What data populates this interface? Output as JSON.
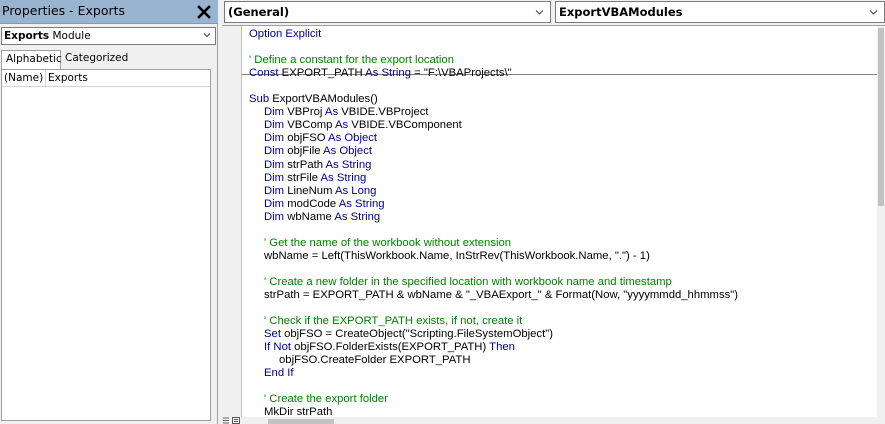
{
  "properties": {
    "title": "Properties - Exports",
    "object_name": "Exports",
    "object_type": "Module",
    "tabs": [
      "Alphabetic",
      "Categorized"
    ],
    "active_tab": "Alphabetic",
    "rows": [
      {
        "name": "(Name)",
        "value": "Exports"
      }
    ]
  },
  "code_window": {
    "general_combo": "(General)",
    "procedure_combo": "ExportVBAModules",
    "lines": [
      {
        "indent": 0,
        "parts": [
          {
            "t": "Option Explicit",
            "k": "kw"
          }
        ]
      },
      {
        "indent": 0,
        "parts": []
      },
      {
        "indent": 0,
        "parts": [
          {
            "t": "' Define a constant for the export location",
            "k": "cm"
          }
        ]
      },
      {
        "indent": 0,
        "parts": [
          {
            "t": "Const",
            "k": "kw"
          },
          {
            "t": " EXPORT_PATH ",
            "k": ""
          },
          {
            "t": "As String",
            "k": "kw"
          },
          {
            "t": " = \"F:\\VBAProjects\\\"",
            "k": ""
          }
        ]
      },
      {
        "indent": 0,
        "parts": []
      },
      {
        "indent": 0,
        "parts": [
          {
            "t": "Sub",
            "k": "kw"
          },
          {
            "t": " ExportVBAModules()",
            "k": ""
          }
        ]
      },
      {
        "indent": 1,
        "parts": [
          {
            "t": "Dim",
            "k": "kw"
          },
          {
            "t": " VBProj ",
            "k": ""
          },
          {
            "t": "As",
            "k": "kw"
          },
          {
            "t": " VBIDE.VBProject",
            "k": ""
          }
        ]
      },
      {
        "indent": 1,
        "parts": [
          {
            "t": "Dim",
            "k": "kw"
          },
          {
            "t": " VBComp ",
            "k": ""
          },
          {
            "t": "As",
            "k": "kw"
          },
          {
            "t": " VBIDE.VBComponent",
            "k": ""
          }
        ]
      },
      {
        "indent": 1,
        "parts": [
          {
            "t": "Dim",
            "k": "kw"
          },
          {
            "t": " objFSO ",
            "k": ""
          },
          {
            "t": "As Object",
            "k": "kw"
          }
        ]
      },
      {
        "indent": 1,
        "parts": [
          {
            "t": "Dim",
            "k": "kw"
          },
          {
            "t": " objFile ",
            "k": ""
          },
          {
            "t": "As Object",
            "k": "kw"
          }
        ]
      },
      {
        "indent": 1,
        "parts": [
          {
            "t": "Dim",
            "k": "kw"
          },
          {
            "t": " strPath ",
            "k": ""
          },
          {
            "t": "As String",
            "k": "kw"
          }
        ]
      },
      {
        "indent": 1,
        "parts": [
          {
            "t": "Dim",
            "k": "kw"
          },
          {
            "t": " strFile ",
            "k": ""
          },
          {
            "t": "As String",
            "k": "kw"
          }
        ]
      },
      {
        "indent": 1,
        "parts": [
          {
            "t": "Dim",
            "k": "kw"
          },
          {
            "t": " LineNum ",
            "k": ""
          },
          {
            "t": "As Long",
            "k": "kw"
          }
        ]
      },
      {
        "indent": 1,
        "parts": [
          {
            "t": "Dim",
            "k": "kw"
          },
          {
            "t": " modCode ",
            "k": ""
          },
          {
            "t": "As String",
            "k": "kw"
          }
        ]
      },
      {
        "indent": 1,
        "parts": [
          {
            "t": "Dim",
            "k": "kw"
          },
          {
            "t": " wbName ",
            "k": ""
          },
          {
            "t": "As String",
            "k": "kw"
          }
        ]
      },
      {
        "indent": 0,
        "parts": []
      },
      {
        "indent": 1,
        "parts": [
          {
            "t": "' Get the name of the workbook without extension",
            "k": "cm"
          }
        ]
      },
      {
        "indent": 1,
        "parts": [
          {
            "t": "wbName = Left(ThisWorkbook.Name, InStrRev(ThisWorkbook.Name, \".\") - 1)",
            "k": ""
          }
        ]
      },
      {
        "indent": 0,
        "parts": []
      },
      {
        "indent": 1,
        "parts": [
          {
            "t": "' Create a new folder in the specified location with workbook name and timestamp",
            "k": "cm"
          }
        ]
      },
      {
        "indent": 1,
        "parts": [
          {
            "t": "strPath = EXPORT_PATH & wbName & \"_VBAExport_\" & Format(Now, \"yyyymmdd_hhmmss\")",
            "k": ""
          }
        ]
      },
      {
        "indent": 0,
        "parts": []
      },
      {
        "indent": 1,
        "parts": [
          {
            "t": "' Check if the EXPORT_PATH exists, if not, create it",
            "k": "cm"
          }
        ]
      },
      {
        "indent": 1,
        "parts": [
          {
            "t": "Set",
            "k": "kw"
          },
          {
            "t": " objFSO = CreateObject(\"Scripting.FileSystemObject\")",
            "k": ""
          }
        ]
      },
      {
        "indent": 1,
        "parts": [
          {
            "t": "If Not",
            "k": "kw"
          },
          {
            "t": " objFSO.FolderExists(EXPORT_PATH) ",
            "k": ""
          },
          {
            "t": "Then",
            "k": "kw"
          }
        ]
      },
      {
        "indent": 2,
        "parts": [
          {
            "t": "objFSO.CreateFolder EXPORT_PATH",
            "k": ""
          }
        ]
      },
      {
        "indent": 1,
        "parts": [
          {
            "t": "End If",
            "k": "kw"
          }
        ]
      },
      {
        "indent": 0,
        "parts": []
      },
      {
        "indent": 1,
        "parts": [
          {
            "t": "' Create the export folder",
            "k": "cm"
          }
        ]
      },
      {
        "indent": 1,
        "parts": [
          {
            "t": "MkDir strPath",
            "k": ""
          }
        ]
      }
    ]
  },
  "colors": {
    "keyword": "#00008b",
    "comment": "#008000",
    "title_bar": "#99b4d1"
  },
  "icons": [
    "close-icon",
    "chevron-down-icon",
    "procedure-view-icon",
    "module-view-icon"
  ]
}
